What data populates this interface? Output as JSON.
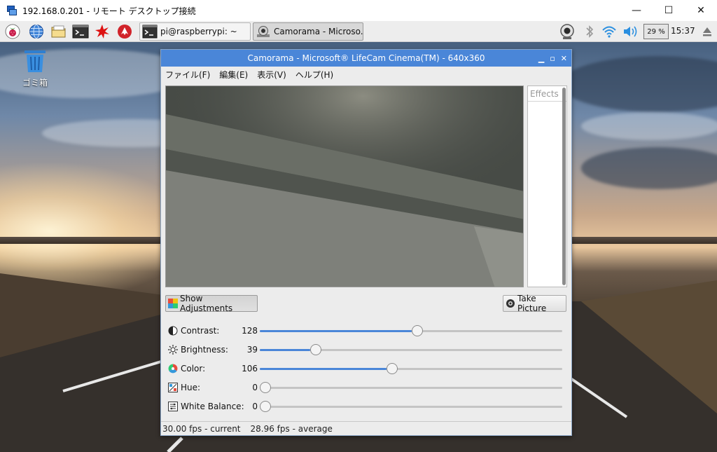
{
  "rdp": {
    "title": "192.168.0.201 - リモート デスクトップ接続",
    "minimize": "—",
    "maximize": "☐",
    "close": "✕"
  },
  "panel": {
    "tasks": [
      {
        "label": "pi@raspberrypi: ~"
      },
      {
        "label": "Camorama - Microso..."
      }
    ],
    "battery": "29 %",
    "clock": "15:37"
  },
  "desktop": {
    "trash_label": "ゴミ箱"
  },
  "camorama": {
    "title": "Camorama - Microsoft® LifeCam Cinema(TM) - 640x360",
    "menu": [
      "ファイル(F)",
      "編集(E)",
      "表示(V)",
      "ヘルプ(H)"
    ],
    "effects_label": "Effects",
    "show_adjustments": "Show Adjustments",
    "take_picture": "Take Picture",
    "sliders": [
      {
        "label": "Contrast:",
        "value": "128",
        "fraction": 0.503
      },
      {
        "label": "Brightness:",
        "value": "39",
        "fraction": 0.167
      },
      {
        "label": "Color:",
        "value": "106",
        "fraction": 0.418
      },
      {
        "label": "Hue:",
        "value": "0",
        "fraction": 0.0
      },
      {
        "label": "White Balance:",
        "value": "0",
        "fraction": 0.0
      }
    ],
    "status_current": "30.00 fps - current",
    "status_average": "28.96 fps - average"
  },
  "colors": {
    "accent": "#4a86d8",
    "titlebar": "#4a86d8"
  }
}
